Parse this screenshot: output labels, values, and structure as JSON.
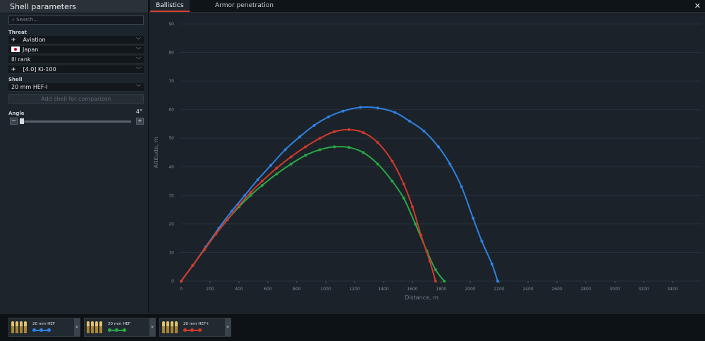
{
  "panel": {
    "title": "Shell parameters",
    "search_placeholder": "Search...",
    "threat_label": "Threat",
    "threat_type": "Aviation",
    "nation": "Japan",
    "rank": "III rank",
    "vehicle": "[4.0] Ki-100",
    "shell_label": "Shell",
    "shell": "20 mm HEF-I",
    "add_shell": "Add shell for comparison",
    "angle_label": "Angle",
    "angle_value": "4°",
    "angle_fraction": 0.02,
    "minus": "−",
    "plus": "+"
  },
  "tabs": [
    {
      "label": "Ballistics",
      "active": true
    },
    {
      "label": "Armor penetration",
      "active": false
    }
  ],
  "close_glyph": "✕",
  "colors": {
    "blue": "#2f80e0",
    "green": "#28a845",
    "red": "#d0392b",
    "grid": "#27313a"
  },
  "chart_data": {
    "type": "line",
    "xlabel": "Distance, m",
    "ylabel": "Altitude, m",
    "xlim": [
      0,
      3600
    ],
    "ylim": [
      0,
      90
    ],
    "xticks": [
      0,
      200,
      400,
      600,
      800,
      1000,
      1200,
      1400,
      1600,
      1800,
      2000,
      2200,
      2400,
      2600,
      2800,
      3000,
      3200,
      3400
    ],
    "yticks": [
      0,
      10,
      20,
      30,
      40,
      50,
      60,
      70,
      80,
      90
    ],
    "grid": true,
    "series": [
      {
        "name": "20 mm HEF",
        "color": "blue",
        "x": [
          0,
          80,
          170,
          260,
          350,
          440,
          530,
          620,
          720,
          820,
          920,
          1020,
          1120,
          1240,
          1360,
          1480,
          1580,
          1680,
          1780,
          1860,
          1940,
          2020,
          2080,
          2150,
          2190
        ],
        "y": [
          0,
          5.5,
          12,
          18.5,
          24.5,
          30,
          35.5,
          40.5,
          46,
          50.5,
          54.5,
          57.5,
          59.5,
          60.8,
          60.6,
          59,
          56,
          52.5,
          47,
          41,
          33,
          22,
          14,
          6,
          0
        ]
      },
      {
        "name": "20 mm HEF",
        "color": "green",
        "x": [
          0,
          80,
          160,
          240,
          320,
          400,
          480,
          560,
          660,
          760,
          860,
          960,
          1060,
          1160,
          1260,
          1360,
          1460,
          1540,
          1620,
          1700,
          1760,
          1820
        ],
        "y": [
          0,
          5.5,
          11,
          16.5,
          21.5,
          26,
          30,
          33.5,
          37.5,
          41,
          44,
          46,
          47,
          46.8,
          45,
          41,
          35,
          29,
          20,
          10.5,
          4,
          0
        ]
      },
      {
        "name": "20 mm HEF-I",
        "color": "red",
        "x": [
          0,
          80,
          160,
          240,
          320,
          400,
          480,
          560,
          660,
          760,
          860,
          960,
          1060,
          1160,
          1260,
          1360,
          1460,
          1540,
          1600,
          1660,
          1720,
          1760
        ],
        "y": [
          0,
          5.5,
          11,
          16.5,
          21.5,
          26.5,
          31,
          35,
          39.5,
          43.5,
          47,
          50,
          52.3,
          53,
          52,
          48.5,
          42,
          34,
          26,
          16,
          7,
          0
        ]
      }
    ]
  },
  "bottom_cards": [
    {
      "name": "20 mm HEF",
      "color": "blue",
      "remove": "×"
    },
    {
      "name": "20 mm HEF",
      "color": "green",
      "remove": "×"
    },
    {
      "name": "20 mm HEF-I",
      "color": "red",
      "remove": "×"
    }
  ]
}
